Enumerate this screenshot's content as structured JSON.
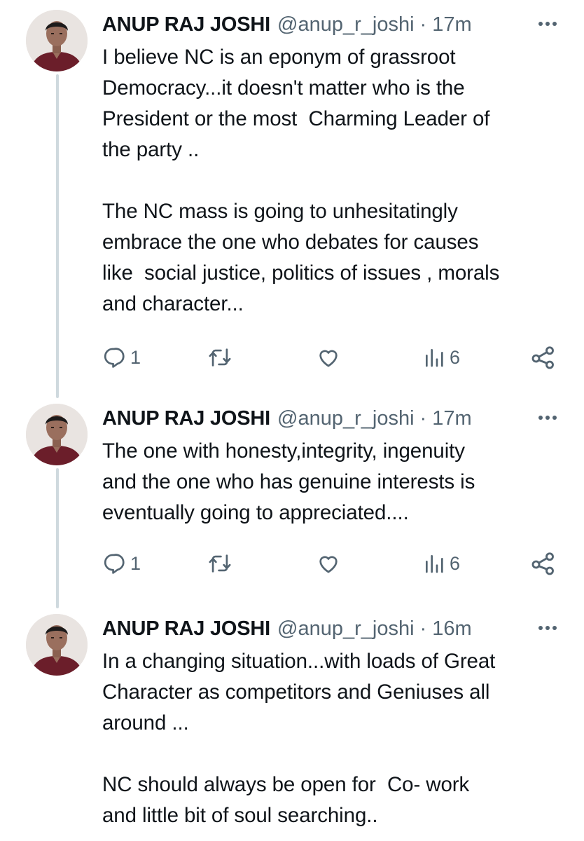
{
  "tweets": [
    {
      "author_name": "ANUP RAJ JOSHI",
      "handle": "@anup_r_joshi",
      "separator": "·",
      "time": "17m",
      "text": "I believe NC is an eponym of grassroot\nDemocracy...it doesn't matter who is the\nPresident or the most  Charming Leader of\nthe party ..\n\nThe NC mass is going to unhesitatingly\nembrace the one who debates for causes\nlike  social justice, politics of issues , morals\nand character...",
      "reply_count": "1",
      "view_count": "6"
    },
    {
      "author_name": "ANUP RAJ JOSHI",
      "handle": "@anup_r_joshi",
      "separator": "·",
      "time": "17m",
      "text": "The one with honesty,integrity, ingenuity\nand the one who has genuine interests is\neventually going to appreciated....",
      "reply_count": "1",
      "view_count": "6"
    },
    {
      "author_name": "ANUP RAJ JOSHI",
      "handle": "@anup_r_joshi",
      "separator": "·",
      "time": "16m",
      "text": "In a changing situation...with loads of Great\nCharacter as competitors and Geniuses all\naround ...\n\nNC should always be open for  Co- work\nand little bit of soul searching..",
      "reply_count": "",
      "view_count": ""
    }
  ],
  "icons": {
    "reply": "reply-icon",
    "retweet": "retweet-icon",
    "like": "like-icon",
    "views": "views-icon",
    "share": "share-icon",
    "more": "more-icon"
  },
  "colors": {
    "text": "#0f1419",
    "secondary": "#536471",
    "thread_line": "#cfd9de",
    "avatar_shirt": "#6b1e2a"
  }
}
